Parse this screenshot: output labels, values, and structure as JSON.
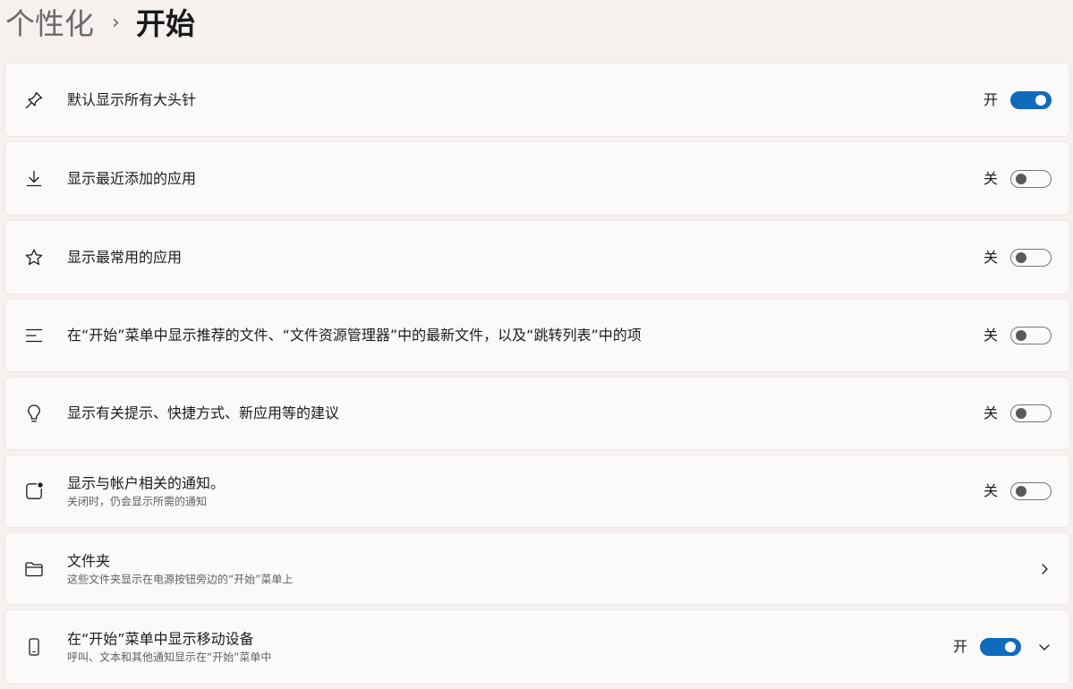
{
  "breadcrumb": {
    "parent": "个性化",
    "separator": "›",
    "current": "开始"
  },
  "settings": [
    {
      "icon": "pin-icon",
      "title": "默认显示所有大头针",
      "subtitle": "",
      "control": "toggle",
      "state_label": "开",
      "on": true
    },
    {
      "icon": "download-icon",
      "title": "显示最近添加的应用",
      "subtitle": "",
      "control": "toggle",
      "state_label": "关",
      "on": false
    },
    {
      "icon": "star-icon",
      "title": "显示最常用的应用",
      "subtitle": "",
      "control": "toggle",
      "state_label": "关",
      "on": false
    },
    {
      "icon": "list-lines-icon",
      "title": "在“开始”菜单中显示推荐的文件、“文件资源管理器”中的最新文件，以及“跳转列表”中的项",
      "subtitle": "",
      "control": "toggle",
      "state_label": "关",
      "on": false
    },
    {
      "icon": "lightbulb-icon",
      "title": "显示有关提示、快捷方式、新应用等的建议",
      "subtitle": "",
      "control": "toggle",
      "state_label": "关",
      "on": false
    },
    {
      "icon": "notification-badge-icon",
      "title": "显示与帐户相关的通知。",
      "subtitle": "关闭时，仍会显示所需的通知",
      "control": "toggle",
      "state_label": "关",
      "on": false
    },
    {
      "icon": "folder-icon",
      "title": "文件夹",
      "subtitle": "这些文件夹显示在电源按钮旁边的“开始”菜单上",
      "control": "chevron-right"
    },
    {
      "icon": "phone-icon",
      "title": "在“开始”菜单中显示移动设备",
      "subtitle": "呼叫、文本和其他通知显示在“开始”菜单中",
      "control": "toggle-expand",
      "state_label": "开",
      "on": true
    }
  ],
  "colors": {
    "accent": "#0f6cbd",
    "background": "#f6f1ef",
    "card": "#fcfaf9"
  }
}
